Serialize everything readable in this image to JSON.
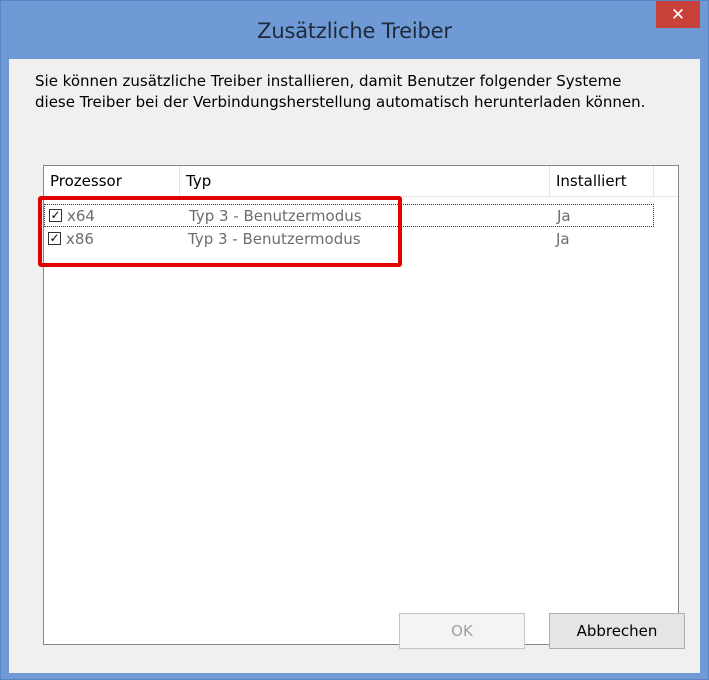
{
  "window": {
    "title": "Zusätzliche Treiber",
    "close_glyph": "✕"
  },
  "description": "Sie können zusätzliche Treiber installieren, damit Benutzer folgender Systeme diese Treiber bei der Verbindungsherstellung automatisch herunterladen können.",
  "table": {
    "columns": [
      "Prozessor",
      "Typ",
      "Installiert"
    ],
    "rows": [
      {
        "checked": true,
        "prozessor": "x64",
        "typ": "Typ 3 - Benutzermodus",
        "installiert": "Ja",
        "focused": true
      },
      {
        "checked": true,
        "prozessor": "x86",
        "typ": "Typ 3 - Benutzermodus",
        "installiert": "Ja",
        "focused": false
      }
    ]
  },
  "buttons": {
    "ok": "OK",
    "cancel": "Abbrechen"
  },
  "colors": {
    "titlebar": "#6f9ad6",
    "close": "#c8413b",
    "highlight": "#e00000"
  },
  "icons": {
    "check": "check-icon",
    "close": "close-icon"
  }
}
